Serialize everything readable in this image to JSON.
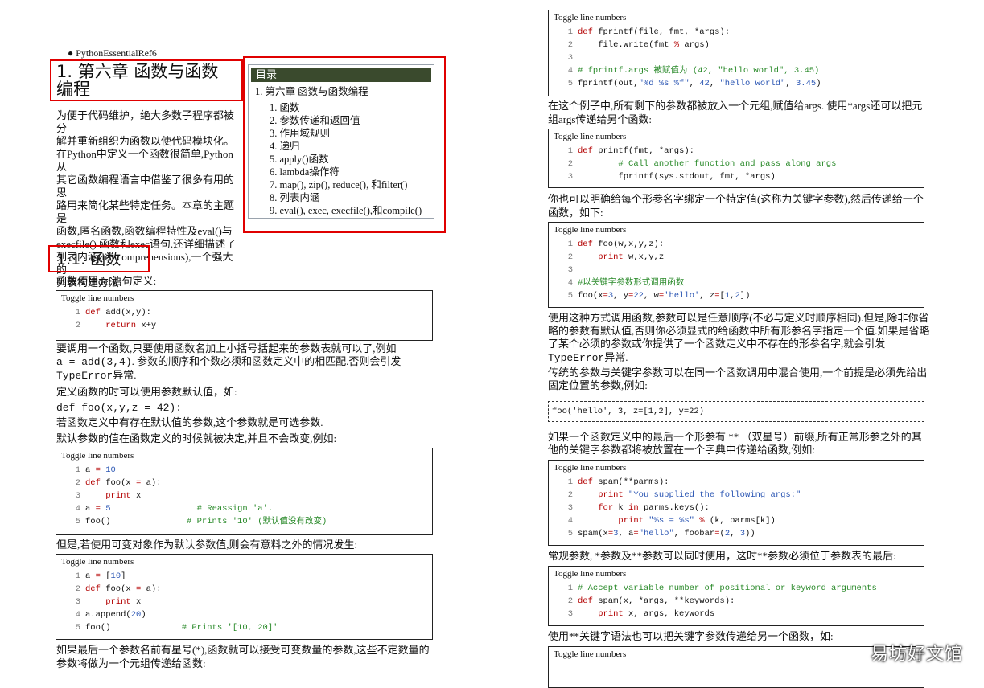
{
  "left": {
    "breadcrumb": "PythonEssentialRef6",
    "chapter_title_line1": "1. 第六章 函数与函数",
    "chapter_title_line2": "编程",
    "intro": [
      "为便于代码维护，绝大多数子程序都被分",
      "解并重新组织为函数以使代码模块化。",
      "在Python中定义一个函数很简单,Python从",
      "其它函数编程语言中借鉴了很多有用的思",
      "路用来简化某些特定任务。本章的主题是",
      "函数,匿名函数,函数编程特性及eval()与",
      "execfile() 函数和exec语句.还详细描述了",
      "列表内涵(list comprehensions),一个强大的",
      "列表构建方法."
    ],
    "toc": {
      "header": "目录",
      "top": "1. 第六章 函数与函数编程",
      "items": [
        "1. 函数",
        "2. 参数传递和返回值",
        "3. 作用域规则",
        "4. 递归",
        "5. apply()函数",
        "6. lambda操作符",
        "7. map(), zip(), reduce(), 和filter()",
        "8. 列表内涵",
        "9. eval(), exec, execfile(),和compile()"
      ]
    },
    "section_title": "1.1. 函数",
    "def_intro": "函数使用def语句定义:",
    "toggle": "Toggle line numbers",
    "call_p1": "要调用一个函数,只要使用函数名加上小括号括起来的参数表就可以了,例如",
    "call_p2a": "a = add(3,4)",
    "call_p2b": ". 参数的顺序和个数必须和函数定义中的相匹配.否则会引发",
    "call_p3a": "TypeError",
    "call_p3b": "异常.",
    "default_p": "定义函数的时可以使用参数默认值，如:",
    "default_code": "def foo(x,y,z = 42):",
    "optional_p": "若函数定义中有存在默认值的参数,这个参数就是可选参数.",
    "fixed_p": "默认参数的值在函数定义的时候就被决定,并且不会改变,例如:",
    "mutable_p": "但是,若使用可变对象作为默认参数值,则会有意料之外的情况发生:",
    "star_p1": "如果最后一个参数名前有星号(*),函数就可以接受可变数量的参数,这些不定数量的",
    "star_p2": "参数将做为一个元组传递给函数:"
  },
  "right": {
    "toggle": "Toggle line numbers",
    "p1a": "在这个例子中,所有剩下的参数都被放入一个元组,赋值给args. 使用*args还可以把元",
    "p1b": "组args传递给另个函数:",
    "p2a": "你也可以明确给每个形参名字绑定一个特定值(这称为关键字参数),然后传递给一个",
    "p2b": "函数，如下:",
    "p3a": "使用这种方式调用函数,参数可以是任意顺序(不必与定义时顺序相同).但是,除非你省",
    "p3b": "略的参数有默认值,否则你必须显式的给函数中所有形参名字指定一个值.如果是省略",
    "p3c": "了某个必须的参数或你提供了一个函数定义中不存在的形参名字,就会引发",
    "p3d_code": "TypeError",
    "p3d": "异常.",
    "p4a": "传统的参数与关键字参数可以在同一个函数调用中混合使用,一个前提是必须先给出",
    "p4b": "固定位置的参数,例如:",
    "dashed_code": "foo('hello', 3, z=[1,2], y=22)",
    "p5a": "如果一个函数定义中的最后一个形参有 ** （双星号）前缀,所有正常形参之外的其",
    "p5b": "他的关键字参数都将被放置在一个字典中传递给函数,例如:",
    "p6": "常规参数, *参数及**参数可以同时使用，这时**参数必须位于参数表的最后:",
    "p7": "使用**关键字语法也可以把关键字参数传递给另一个函数，如:"
  },
  "code_blocks": {
    "add": [
      {
        "n": "1",
        "segs": [
          {
            "t": "def",
            "c": "kw"
          },
          {
            "t": " add(x,y):"
          }
        ]
      },
      {
        "n": "2",
        "segs": [
          {
            "t": "    "
          },
          {
            "t": "return",
            "c": "kw"
          },
          {
            "t": " x+y"
          }
        ]
      }
    ],
    "default_fixed": [
      {
        "n": "1",
        "segs": [
          {
            "t": "a "
          },
          {
            "t": "=",
            "c": "kw"
          },
          {
            "t": " "
          },
          {
            "t": "10",
            "c": "nm"
          }
        ]
      },
      {
        "n": "2",
        "segs": [
          {
            "t": "def",
            "c": "kw"
          },
          {
            "t": " foo(x "
          },
          {
            "t": "=",
            "c": "kw"
          },
          {
            "t": " a):"
          }
        ]
      },
      {
        "n": "3",
        "segs": [
          {
            "t": "    "
          },
          {
            "t": "print",
            "c": "kw"
          },
          {
            "t": " x"
          }
        ]
      },
      {
        "n": "4",
        "segs": [
          {
            "t": "a "
          },
          {
            "t": "=",
            "c": "kw"
          },
          {
            "t": " "
          },
          {
            "t": "5",
            "c": "nm"
          },
          {
            "t": "                 "
          },
          {
            "t": "# Reassign 'a'.",
            "c": "cm"
          }
        ]
      },
      {
        "n": "5",
        "segs": [
          {
            "t": "foo()               "
          },
          {
            "t": "# Prints '10' (默认值没有改变)",
            "c": "cm"
          }
        ]
      }
    ],
    "mutable": [
      {
        "n": "1",
        "segs": [
          {
            "t": "a "
          },
          {
            "t": "=",
            "c": "kw"
          },
          {
            "t": " ["
          },
          {
            "t": "10",
            "c": "nm"
          },
          {
            "t": "]"
          }
        ]
      },
      {
        "n": "2",
        "segs": [
          {
            "t": "def",
            "c": "kw"
          },
          {
            "t": " foo(x "
          },
          {
            "t": "=",
            "c": "kw"
          },
          {
            "t": " a):"
          }
        ]
      },
      {
        "n": "3",
        "segs": [
          {
            "t": "    "
          },
          {
            "t": "print",
            "c": "kw"
          },
          {
            "t": " x"
          }
        ]
      },
      {
        "n": "4",
        "segs": [
          {
            "t": "a.append("
          },
          {
            "t": "20",
            "c": "nm"
          },
          {
            "t": ")"
          }
        ]
      },
      {
        "n": "5",
        "segs": [
          {
            "t": "foo()              "
          },
          {
            "t": "# Prints '[10, 20]'",
            "c": "cm"
          }
        ]
      }
    ],
    "fprintf": [
      {
        "n": "1",
        "segs": [
          {
            "t": "def",
            "c": "kw"
          },
          {
            "t": " fprintf(file, fmt, *args):"
          }
        ]
      },
      {
        "n": "2",
        "segs": [
          {
            "t": "    file.write(fmt "
          },
          {
            "t": "%",
            "c": "kw"
          },
          {
            "t": " args)"
          }
        ]
      },
      {
        "n": "3",
        "segs": [
          {
            "t": ""
          }
        ]
      },
      {
        "n": "4",
        "segs": [
          {
            "t": "# fprintf.args 被赋值为 (42, \"hello world\", 3.45)",
            "c": "cm"
          }
        ]
      },
      {
        "n": "5",
        "segs": [
          {
            "t": "fprintf(out,"
          },
          {
            "t": "\"%d %s %f\"",
            "c": "st"
          },
          {
            "t": ", "
          },
          {
            "t": "42",
            "c": "nm"
          },
          {
            "t": ", "
          },
          {
            "t": "\"hello world\"",
            "c": "st"
          },
          {
            "t": ", "
          },
          {
            "t": "3.45",
            "c": "nm"
          },
          {
            "t": ")"
          }
        ]
      }
    ],
    "printf": [
      {
        "n": "1",
        "segs": [
          {
            "t": "def",
            "c": "kw"
          },
          {
            "t": " printf(fmt, *args):"
          }
        ]
      },
      {
        "n": "2",
        "segs": [
          {
            "t": "        "
          },
          {
            "t": "# Call another function and pass along args",
            "c": "cm"
          }
        ]
      },
      {
        "n": "3",
        "segs": [
          {
            "t": "        fprintf(sys.stdout, fmt, *args)"
          }
        ]
      }
    ],
    "foo_kw": [
      {
        "n": "1",
        "segs": [
          {
            "t": "def",
            "c": "kw"
          },
          {
            "t": " foo(w,x,y,z):"
          }
        ]
      },
      {
        "n": "2",
        "segs": [
          {
            "t": "    "
          },
          {
            "t": "print",
            "c": "kw"
          },
          {
            "t": " w,x,y,z"
          }
        ]
      },
      {
        "n": "3",
        "segs": [
          {
            "t": ""
          }
        ]
      },
      {
        "n": "4",
        "segs": [
          {
            "t": "#以关键字参数形式调用函数",
            "c": "cm"
          }
        ]
      },
      {
        "n": "5",
        "segs": [
          {
            "t": "foo(x"
          },
          {
            "t": "=",
            "c": "kw"
          },
          {
            "t": "3",
            "c": "nm"
          },
          {
            "t": ", y"
          },
          {
            "t": "=",
            "c": "kw"
          },
          {
            "t": "22",
            "c": "nm"
          },
          {
            "t": ", w"
          },
          {
            "t": "=",
            "c": "kw"
          },
          {
            "t": "'hello'",
            "c": "st"
          },
          {
            "t": ", z"
          },
          {
            "t": "=",
            "c": "kw"
          },
          {
            "t": "["
          },
          {
            "t": "1",
            "c": "nm"
          },
          {
            "t": ","
          },
          {
            "t": "2",
            "c": "nm"
          },
          {
            "t": "])"
          }
        ]
      }
    ],
    "spam_kw": [
      {
        "n": "1",
        "segs": [
          {
            "t": "def",
            "c": "kw"
          },
          {
            "t": " spam(**parms):"
          }
        ]
      },
      {
        "n": "2",
        "segs": [
          {
            "t": "    "
          },
          {
            "t": "print",
            "c": "kw"
          },
          {
            "t": " "
          },
          {
            "t": "\"You supplied the following args:\"",
            "c": "st"
          }
        ]
      },
      {
        "n": "3",
        "segs": [
          {
            "t": "    "
          },
          {
            "t": "for",
            "c": "kw"
          },
          {
            "t": " k "
          },
          {
            "t": "in",
            "c": "kw"
          },
          {
            "t": " parms.keys():"
          }
        ]
      },
      {
        "n": "4",
        "segs": [
          {
            "t": "        "
          },
          {
            "t": "print",
            "c": "kw"
          },
          {
            "t": " "
          },
          {
            "t": "\"%s = %s\"",
            "c": "st"
          },
          {
            "t": " "
          },
          {
            "t": "%",
            "c": "kw"
          },
          {
            "t": " (k, parms[k])"
          }
        ]
      },
      {
        "n": "5",
        "segs": [
          {
            "t": "spam(x"
          },
          {
            "t": "=",
            "c": "kw"
          },
          {
            "t": "3",
            "c": "nm"
          },
          {
            "t": ", a"
          },
          {
            "t": "=",
            "c": "kw"
          },
          {
            "t": "\"hello\"",
            "c": "st"
          },
          {
            "t": ", foobar"
          },
          {
            "t": "=",
            "c": "kw"
          },
          {
            "t": "("
          },
          {
            "t": "2",
            "c": "nm"
          },
          {
            "t": ", "
          },
          {
            "t": "3",
            "c": "nm"
          },
          {
            "t": "))"
          }
        ]
      }
    ],
    "spam_var": [
      {
        "n": "1",
        "segs": [
          {
            "t": "# Accept variable number of positional or keyword arguments",
            "c": "cm"
          }
        ]
      },
      {
        "n": "2",
        "segs": [
          {
            "t": "def",
            "c": "kw"
          },
          {
            "t": " spam(x, *args, **keywords):"
          }
        ]
      },
      {
        "n": "3",
        "segs": [
          {
            "t": "    "
          },
          {
            "t": "print",
            "c": "kw"
          },
          {
            "t": " x, args, keywords"
          }
        ]
      }
    ]
  },
  "watermark": "易坊好文馆",
  "colors": {
    "highlight_border": "#e00000",
    "keyword": "#b30000",
    "comment": "#2a8a2a",
    "string": "#2a55b3",
    "toc_header_bg": "#3a4a2d"
  }
}
